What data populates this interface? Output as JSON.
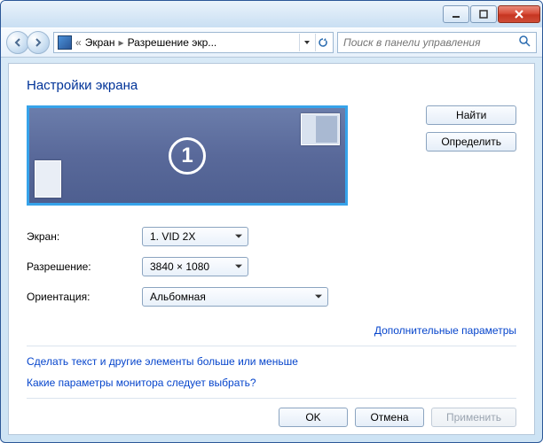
{
  "titlebar": {},
  "nav": {
    "breadcrumb": {
      "item1": "Экран",
      "item2": "Разрешение экр..."
    },
    "search_placeholder": "Поиск в панели управления"
  },
  "heading": "Настройки экрана",
  "preview": {
    "monitor_number": "1"
  },
  "side_buttons": {
    "find": "Найти",
    "identify": "Определить"
  },
  "form": {
    "screen_label": "Экран:",
    "screen_value": "1. VID 2X",
    "res_label": "Разрешение:",
    "res_value": "3840 × 1080",
    "orient_label": "Ориентация:",
    "orient_value": "Альбомная"
  },
  "links": {
    "advanced": "Дополнительные параметры",
    "text_size": "Сделать текст и другие элементы больше или меньше",
    "which_settings": "Какие параметры монитора следует выбрать?"
  },
  "footer": {
    "ok": "OK",
    "cancel": "Отмена",
    "apply": "Применить"
  }
}
